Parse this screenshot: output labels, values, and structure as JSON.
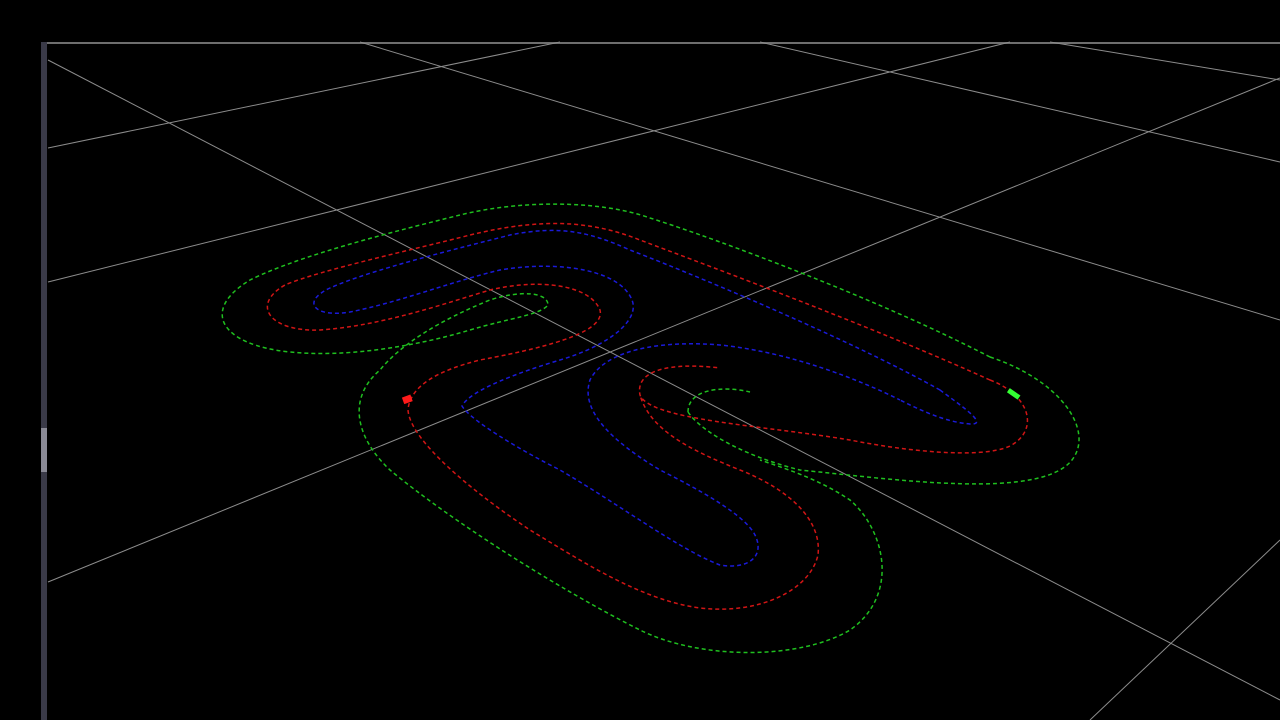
{
  "scene": {
    "background_color": "#000000",
    "grid_color": "#8c8c8c",
    "track_lines": [
      {
        "name": "outer-boundary",
        "color": "#1fbf1f"
      },
      {
        "name": "center-line",
        "color": "#d01515"
      },
      {
        "name": "inner-boundary",
        "color": "#1a1ad8"
      }
    ],
    "start_marker_color": "#ff1a1a",
    "vehicle_marker_color": "#33ff33"
  }
}
